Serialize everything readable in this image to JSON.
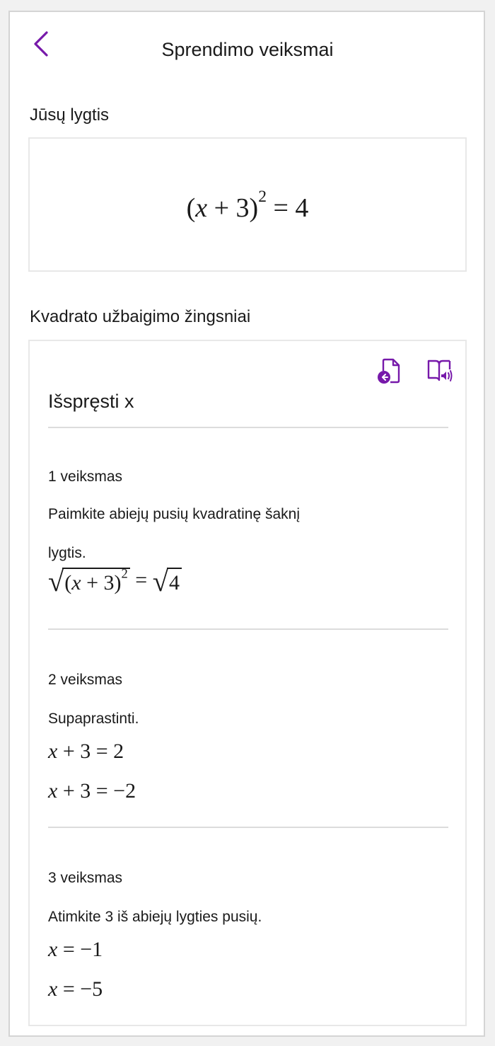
{
  "header": {
    "title": "Sprendimo veiksmai",
    "back_icon": "chevron-left-icon",
    "accent_color": "#7719aa"
  },
  "equation_section": {
    "label": "Jūsų lygtis",
    "equation": {
      "base": "(x + 3)",
      "exponent": "2",
      "rhs": "= 4"
    }
  },
  "steps_section": {
    "label": "Kvadrato užbaigimo žingsniai",
    "icons": [
      "insert-to-page-icon",
      "immersive-reader-icon"
    ],
    "solve_title": "Išspręsti x",
    "steps": [
      {
        "label": "1 veiksmas",
        "text_line1": "Paimkite abiejų pusių kvadratinę šaknį",
        "text_line2": "lygtis.",
        "math": {
          "sqrt_left_base": "(x + 3)",
          "sqrt_left_exp": "2",
          "eq": "=",
          "sqrt_right": "4"
        }
      },
      {
        "label": "2 veiksmas",
        "text": "Supaprastinti.",
        "math": [
          "x + 3 = 2",
          "x + 3 = −2"
        ]
      },
      {
        "label": "3 veiksmas",
        "text": "Atimkite 3 iš abiejų lygties pusių.",
        "math": [
          "x = −1",
          "x = −5"
        ]
      }
    ]
  }
}
